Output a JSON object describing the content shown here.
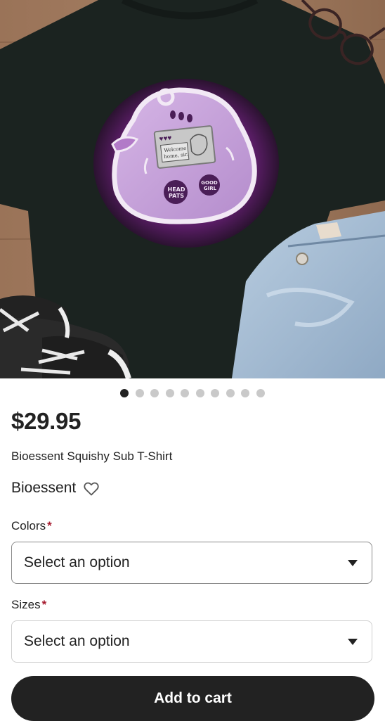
{
  "product": {
    "image_icon": "tshirt-product-photo",
    "artwork_text": {
      "screen_line1": "Welcome",
      "screen_line2": "home, sir.",
      "button_left_line1": "HEAD",
      "button_left_line2": "PATS",
      "button_right_line1": "GOOD",
      "button_right_line2": "GIRL"
    },
    "carousel": {
      "count": 10,
      "active_index": 0
    },
    "price": "$29.95",
    "title": "Bioessent Squishy Sub T-Shirt",
    "shop_name": "Bioessent",
    "favorite_icon": "heart-outline-icon"
  },
  "options": {
    "colors": {
      "label": "Colors",
      "required_mark": "*",
      "value": "Select an option"
    },
    "sizes": {
      "label": "Sizes",
      "required_mark": "*",
      "value": "Select an option"
    }
  },
  "actions": {
    "add_to_cart": "Add to cart"
  },
  "colors": {
    "text": "#222222",
    "required": "#a61a2e",
    "button": "#222222",
    "dot_inactive": "#c9c9c9"
  }
}
